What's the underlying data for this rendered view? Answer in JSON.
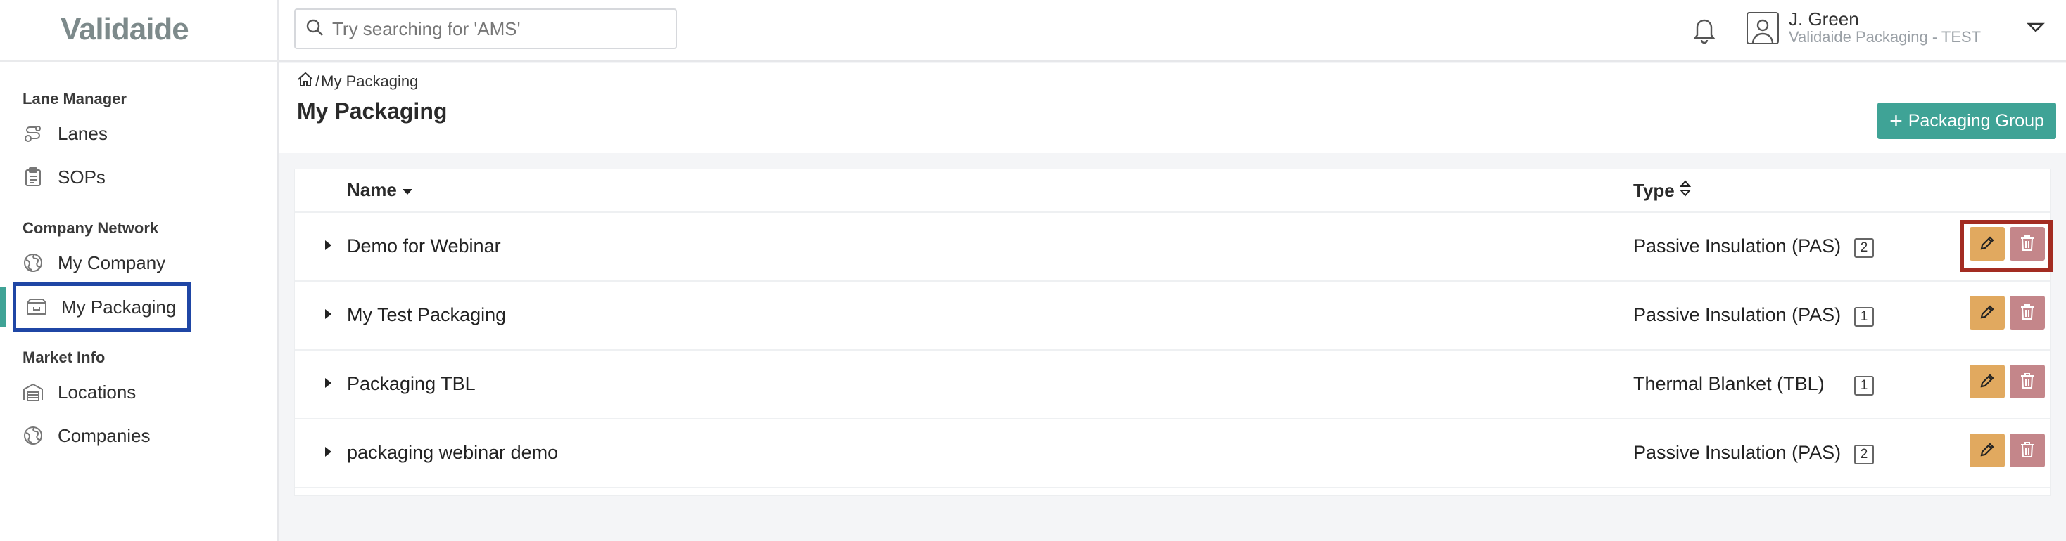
{
  "app": {
    "logo_text": "Validaide"
  },
  "sidebar": {
    "sections": [
      {
        "title": "Lane Manager",
        "items": [
          {
            "label": "Lanes",
            "icon": "route-icon"
          },
          {
            "label": "SOPs",
            "icon": "clipboard-icon"
          }
        ]
      },
      {
        "title": "Company Network",
        "items": [
          {
            "label": "My Company",
            "icon": "globe-icon"
          },
          {
            "label": "My Packaging",
            "icon": "package-icon",
            "active": true
          }
        ]
      },
      {
        "title": "Market Info",
        "items": [
          {
            "label": "Locations",
            "icon": "warehouse-icon"
          },
          {
            "label": "Companies",
            "icon": "globe-icon"
          }
        ]
      }
    ]
  },
  "header": {
    "search_placeholder": "Try searching for 'AMS'",
    "user_name": "J. Green",
    "user_org": "Validaide Packaging - TEST"
  },
  "page": {
    "breadcrumb_current": "My Packaging",
    "title": "My Packaging",
    "add_button_label": "Packaging Group"
  },
  "table": {
    "columns": {
      "name": "Name",
      "type": "Type"
    },
    "rows": [
      {
        "name": "Demo for Webinar",
        "type": "Passive Insulation (PAS)",
        "count": "2"
      },
      {
        "name": "My Test Packaging",
        "type": "Passive Insulation (PAS)",
        "count": "1"
      },
      {
        "name": "Packaging TBL",
        "type": "Thermal Blanket (TBL)",
        "count": "1"
      },
      {
        "name": "packaging webinar demo",
        "type": "Passive Insulation (PAS)",
        "count": "2"
      }
    ]
  },
  "colors": {
    "accent": "#3fa396",
    "edit": "#e1a95f",
    "delete": "#c4868a",
    "active_outline": "#1f46a5",
    "highlight": "#a32c22"
  }
}
